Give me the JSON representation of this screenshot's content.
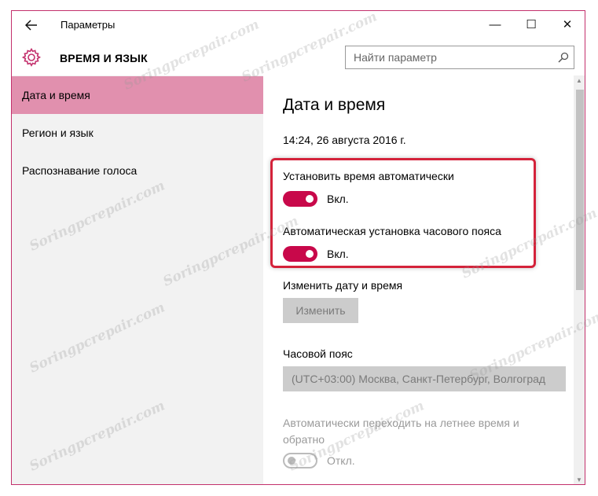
{
  "window": {
    "title": "Параметры",
    "accent": "#c3306c",
    "controls": {
      "minimize": "—",
      "maximize": "☐",
      "close": "✕"
    }
  },
  "header": {
    "section_title": "ВРЕМЯ И ЯЗЫК",
    "icon": "gear-icon",
    "search_placeholder": "Найти параметр"
  },
  "sidebar": {
    "items": [
      {
        "label": "Дата и время",
        "active": true
      },
      {
        "label": "Регион и язык",
        "active": false
      },
      {
        "label": "Распознавание голоса",
        "active": false
      }
    ],
    "active_color": "#e190ae"
  },
  "main": {
    "title": "Дата и время",
    "current_datetime": "14:24, 26 августа 2016 г.",
    "auto_time": {
      "label": "Установить время автоматически",
      "state": "Вкл.",
      "on": true
    },
    "auto_timezone": {
      "label": "Автоматическая установка часового пояса",
      "state": "Вкл.",
      "on": true
    },
    "change_datetime": {
      "label": "Изменить дату и время",
      "button": "Изменить",
      "enabled": false
    },
    "timezone": {
      "label": "Часовой пояс",
      "value": "(UTC+03:00) Москва, Санкт-Петербург, Волгоград",
      "enabled": false
    },
    "dst": {
      "label_line1": "Автоматически переходить на летнее время и",
      "label_line2": "обратно",
      "state": "Откл.",
      "on": false,
      "enabled": false
    },
    "toggle_on_color": "#c8084a"
  },
  "watermark": "Soringpcrepair.com"
}
